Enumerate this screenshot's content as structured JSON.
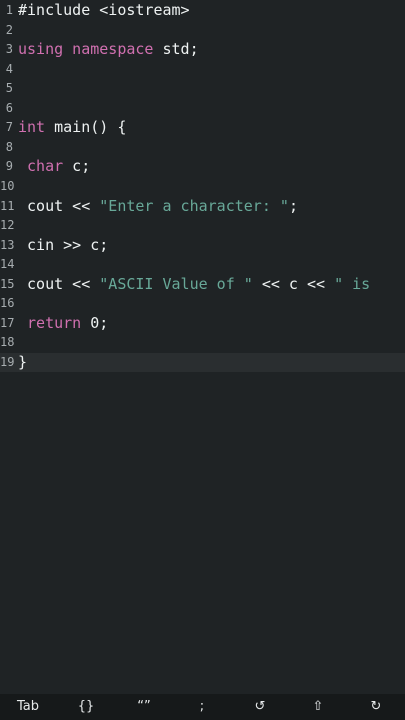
{
  "editor": {
    "lines": [
      {
        "n": "1",
        "tokens": [
          {
            "t": "#include <iostream>",
            "c": "plain"
          }
        ]
      },
      {
        "n": "2",
        "tokens": []
      },
      {
        "n": "3",
        "tokens": [
          {
            "t": "using namespace",
            "c": "kw"
          },
          {
            "t": " std;",
            "c": "plain"
          }
        ]
      },
      {
        "n": "4",
        "tokens": []
      },
      {
        "n": "5",
        "tokens": []
      },
      {
        "n": "6",
        "tokens": []
      },
      {
        "n": "7",
        "tokens": [
          {
            "t": "int",
            "c": "kw"
          },
          {
            "t": " main() {",
            "c": "plain"
          }
        ]
      },
      {
        "n": "8",
        "tokens": []
      },
      {
        "n": "9",
        "tokens": [
          {
            "t": " ",
            "c": "plain"
          },
          {
            "t": "char",
            "c": "kw"
          },
          {
            "t": " c;",
            "c": "plain"
          }
        ]
      },
      {
        "n": "10",
        "tokens": []
      },
      {
        "n": "11",
        "tokens": [
          {
            "t": " cout << ",
            "c": "plain"
          },
          {
            "t": "\"Enter a character: \"",
            "c": "str"
          },
          {
            "t": ";",
            "c": "plain"
          }
        ]
      },
      {
        "n": "12",
        "tokens": []
      },
      {
        "n": "13",
        "tokens": [
          {
            "t": " cin >> c;",
            "c": "plain"
          }
        ]
      },
      {
        "n": "14",
        "tokens": []
      },
      {
        "n": "15",
        "tokens": [
          {
            "t": " cout << ",
            "c": "plain"
          },
          {
            "t": "\"ASCII Value of \"",
            "c": "str"
          },
          {
            "t": " << c << ",
            "c": "plain"
          },
          {
            "t": "\" is",
            "c": "str"
          }
        ]
      },
      {
        "n": "16",
        "tokens": []
      },
      {
        "n": "17",
        "tokens": [
          {
            "t": " ",
            "c": "plain"
          },
          {
            "t": "return",
            "c": "kw"
          },
          {
            "t": " 0;",
            "c": "plain"
          }
        ]
      },
      {
        "n": "18",
        "tokens": []
      },
      {
        "n": "19",
        "tokens": [
          {
            "t": "}",
            "c": "plain"
          }
        ],
        "current": true
      }
    ]
  },
  "toolbar": {
    "keys": [
      {
        "label": "Tab",
        "name": "tab-key"
      },
      {
        "label": "{}",
        "name": "braces-key"
      },
      {
        "label": "“”",
        "name": "quotes-key"
      },
      {
        "label": ";",
        "name": "semicolon-key"
      },
      {
        "label": "↺",
        "name": "undo-key"
      },
      {
        "label": "⇧",
        "name": "shift-key"
      },
      {
        "label": "↻",
        "name": "redo-key"
      }
    ]
  },
  "colors": {
    "background": "#1f2325",
    "keyword": "#d070b0",
    "string": "#68a898",
    "text": "#eef2f2",
    "line_number": "#a7adb0",
    "toolbar_background": "#16191a"
  }
}
